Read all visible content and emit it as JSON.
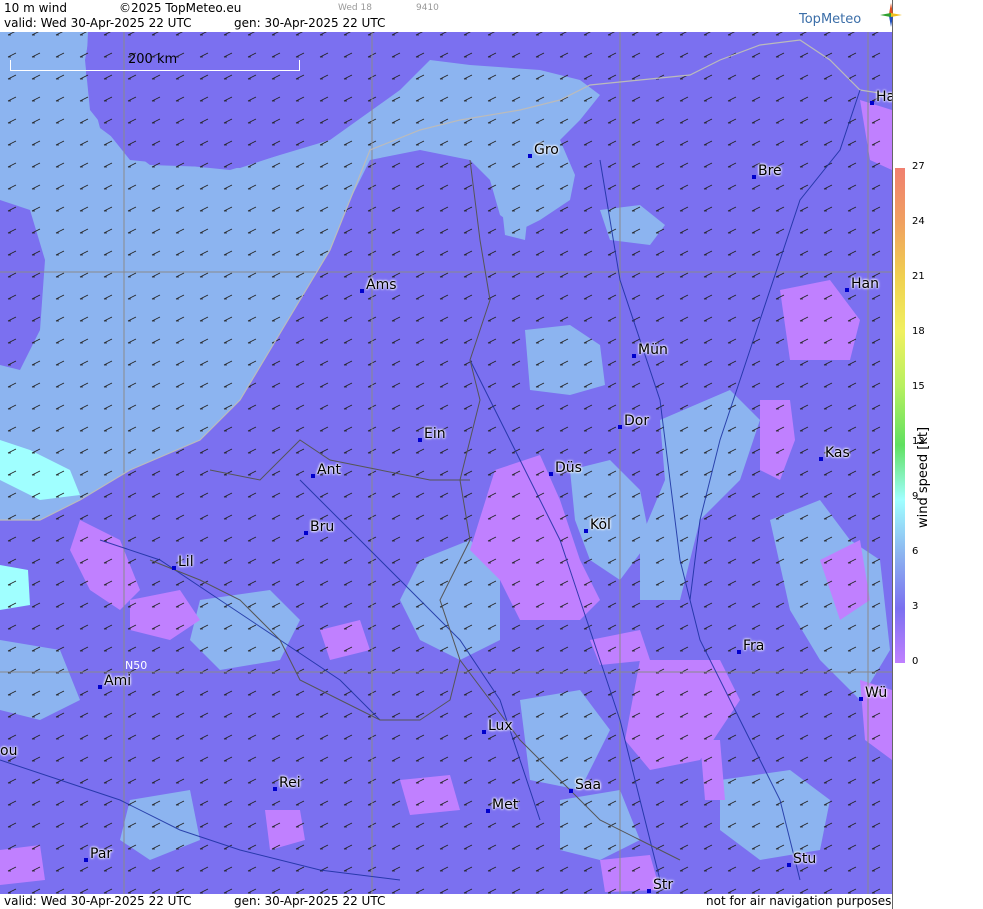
{
  "header": {
    "product": "10 m wind",
    "copyright": "©2025 TopMeteo.eu",
    "small_time": "Wed 18",
    "small_code": "9410",
    "valid": "valid:  Wed  30-Apr-2025  22 UTC",
    "gen": "gen: 30-Apr-2025  22 UTC",
    "logo": "TopMeteo"
  },
  "scale_bar": {
    "label": "200 km"
  },
  "grid_label": "N50",
  "footer": {
    "valid": "valid:  Wed  30-Apr-2025  22 UTC",
    "gen": "gen: 30-Apr-2025  22 UTC",
    "disclaimer": "not for air navigation purposes"
  },
  "legend": {
    "unit": "wind  speed  [kt]",
    "ticks": [
      "27",
      "24",
      "21",
      "18",
      "15",
      "12",
      "9",
      "6",
      "3",
      "0"
    ],
    "colors": [
      "#f08070",
      "#f0a060",
      "#f0d050",
      "#f0f060",
      "#b8f060",
      "#60e060",
      "#a0ffff",
      "#8cb4f0",
      "#7b70f0",
      "#c080ff"
    ]
  },
  "cities": [
    {
      "name": "Gro"
    },
    {
      "name": "Bre"
    },
    {
      "name": "Ha"
    },
    {
      "name": "Ams"
    },
    {
      "name": "Han"
    },
    {
      "name": "Mün"
    },
    {
      "name": "Dor"
    },
    {
      "name": "Ein"
    },
    {
      "name": "Kas"
    },
    {
      "name": "Ant"
    },
    {
      "name": "Düs"
    },
    {
      "name": "Bru"
    },
    {
      "name": "Köl"
    },
    {
      "name": "Lil"
    },
    {
      "name": "Fra"
    },
    {
      "name": "Ami"
    },
    {
      "name": "Wü"
    },
    {
      "name": "Lux"
    },
    {
      "name": "ou"
    },
    {
      "name": "Rei"
    },
    {
      "name": "Saa"
    },
    {
      "name": "Met"
    },
    {
      "name": "Par"
    },
    {
      "name": "Stu"
    },
    {
      "name": "Str"
    }
  ]
}
